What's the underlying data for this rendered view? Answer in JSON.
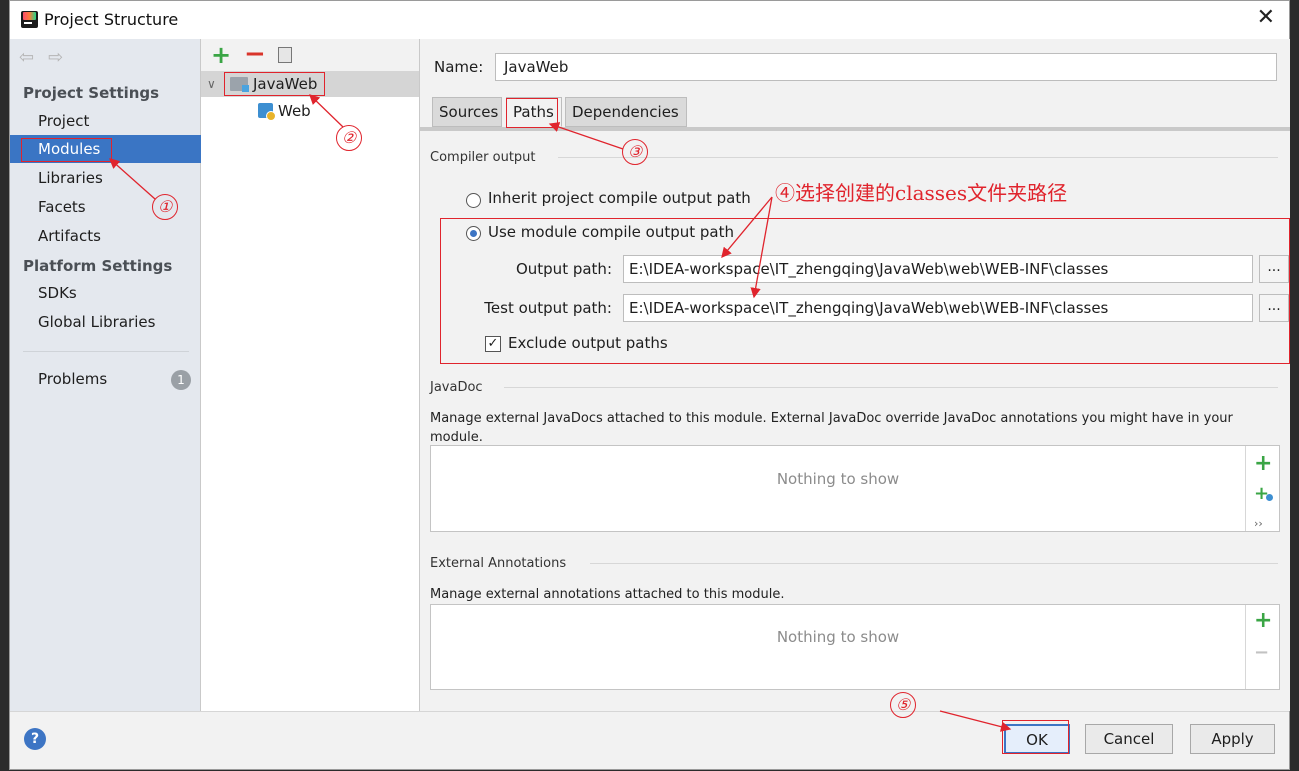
{
  "window": {
    "title": "Project Structure"
  },
  "sidebar": {
    "project_settings_title": "Project Settings",
    "platform_settings_title": "Platform Settings",
    "items": [
      {
        "label": "Project"
      },
      {
        "label": "Modules"
      },
      {
        "label": "Libraries"
      },
      {
        "label": "Facets"
      },
      {
        "label": "Artifacts"
      }
    ],
    "platform_items": [
      {
        "label": "SDKs"
      },
      {
        "label": "Global Libraries"
      }
    ],
    "problems": {
      "label": "Problems",
      "count": "1"
    }
  },
  "tree": {
    "root": {
      "label": "JavaWeb"
    },
    "child": {
      "label": "Web"
    }
  },
  "main": {
    "name_label": "Name:",
    "name_value": "JavaWeb",
    "tabs": [
      {
        "label": "Sources"
      },
      {
        "label": "Paths"
      },
      {
        "label": "Dependencies"
      }
    ],
    "compiler_output": {
      "title": "Compiler output",
      "inherit_label": "Inherit project compile output path",
      "use_module_label": "Use module compile output path",
      "output_path_label": "Output path:",
      "output_path_value": "E:\\IDEA-workspace\\IT_zhengqing\\JavaWeb\\web\\WEB-INF\\classes",
      "test_output_path_label": "Test output path:",
      "test_output_path_value": "E:\\IDEA-workspace\\IT_zhengqing\\JavaWeb\\web\\WEB-INF\\classes",
      "browse_label": "...",
      "exclude_label": "Exclude output paths",
      "exclude_checked": true
    },
    "javadoc": {
      "title": "JavaDoc",
      "description": "Manage external JavaDocs attached to this module. External JavaDoc override JavaDoc annotations you might have in your module.",
      "empty": "Nothing to show"
    },
    "external_annotations": {
      "title": "External Annotations",
      "description": "Manage external annotations attached to this module.",
      "empty": "Nothing to show"
    }
  },
  "buttons": {
    "help": "?",
    "ok": "OK",
    "cancel": "Cancel",
    "apply": "Apply"
  },
  "annotations": {
    "n1": "①",
    "n2": "②",
    "n3": "③",
    "n4_text": "④选择创建的classes文件夹路径",
    "n5": "⑤",
    "color": "#e0242d"
  },
  "icons": {
    "close": "close-icon",
    "add": "plus-icon",
    "remove": "minus-icon",
    "copy": "copy-icon",
    "back": "arrow-left-icon",
    "forward": "arrow-right-icon"
  }
}
